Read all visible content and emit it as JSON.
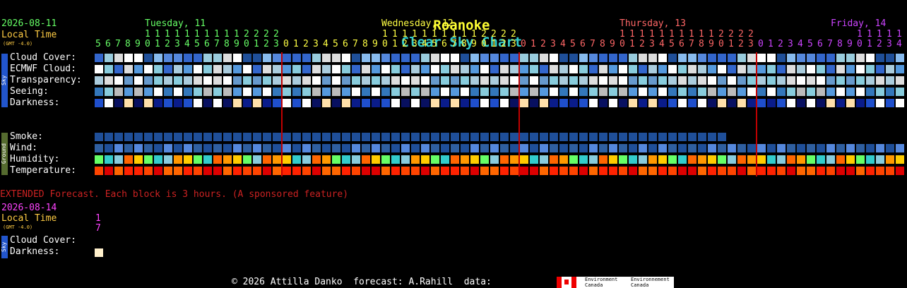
{
  "title": {
    "place": "Roanoke",
    "rest": "Clear Sky Chart"
  },
  "header": {
    "date": "2026-08-11",
    "local_time": "Local Time",
    "gmt": "(GMT -4.0)",
    "days": [
      {
        "label": "Tuesday, 11",
        "color": "#66ff66"
      },
      {
        "label": "Wednesday, 12",
        "color": "#ffff44"
      },
      {
        "label": "Thursday, 13",
        "color": "#ff6666"
      },
      {
        "label": "Friday, 14",
        "color": "#cc44ff"
      }
    ],
    "hours": [
      5,
      6,
      7,
      8,
      9,
      10,
      11,
      12,
      13,
      14,
      15,
      16,
      17,
      18,
      19,
      20,
      21,
      22,
      23,
      0,
      1,
      2,
      3,
      4,
      5,
      6,
      7,
      8,
      9,
      10,
      11,
      12,
      13,
      14,
      15,
      16,
      17,
      18,
      19,
      20,
      21,
      22,
      23,
      0,
      1,
      2,
      3,
      4,
      5,
      6,
      7,
      8,
      9,
      10,
      11,
      12,
      13,
      14,
      15,
      16,
      17,
      18,
      19,
      20,
      21,
      22,
      23,
      0,
      1,
      2,
      3,
      4,
      5,
      6,
      7,
      8,
      9,
      10,
      11,
      12,
      13,
      14
    ]
  },
  "sky_rows": [
    "Cloud Cover:",
    "ECMWF Cloud:",
    "Transparency:",
    "Seeing:",
    "Darkness:"
  ],
  "ground_rows": [
    "Smoke:",
    "Wind:",
    "Humidity:",
    "Temperature:"
  ],
  "side_labels": {
    "sky": "Sky",
    "ground": "Ground"
  },
  "extended": {
    "note": "EXTENDED Forecast. Each block is 3 hours. (A sponsored feature)",
    "date": "2026-08-14",
    "local_time": "Local Time",
    "gmt": "(GMT -4.0)",
    "hour_top": "1",
    "hour_bottom": "7",
    "rows": [
      "Cloud Cover:",
      "Darkness:"
    ]
  },
  "footer": {
    "credit": "© 2026 Attilla Danko  forecast: A.Rahill  data:",
    "env_en_1": "Environment",
    "env_en_2": "Canada",
    "env_fr_1": "Environnement",
    "env_fr_2": "Canada"
  },
  "colors": {
    "title_place": "#ffff33",
    "title_rest": "#33cccc",
    "date": "#66ff66",
    "local_time": "#ffcc44",
    "extended_note": "#cc2222",
    "extended_date": "#ff44ff"
  }
}
